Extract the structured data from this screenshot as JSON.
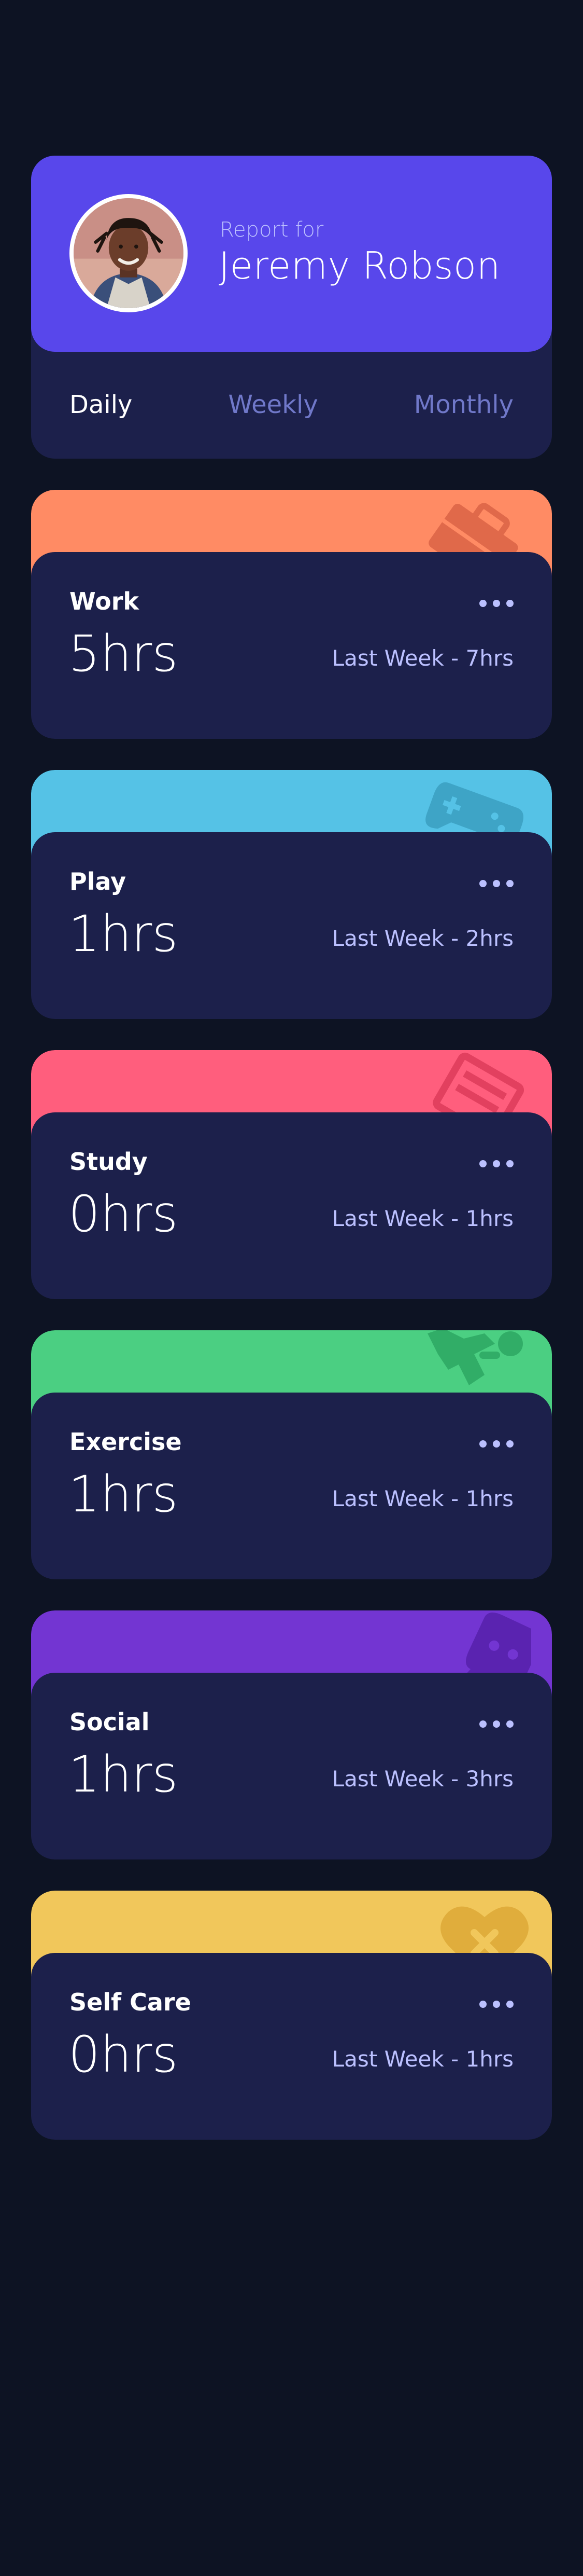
{
  "profile": {
    "report_for": "Report for",
    "name": "Jeremy Robson",
    "periods": [
      "Daily",
      "Weekly",
      "Monthly"
    ],
    "active_period": "Daily"
  },
  "activities": [
    {
      "title": "Work",
      "hours": "5hrs",
      "previous": "Last Week - 7hrs",
      "color": "#ff8b64",
      "icon": "briefcase-icon"
    },
    {
      "title": "Play",
      "hours": "1hrs",
      "previous": "Last Week - 2hrs",
      "color": "#55c2e6",
      "icon": "gamepad-icon"
    },
    {
      "title": "Study",
      "hours": "0hrs",
      "previous": "Last Week - 1hrs",
      "color": "#ff5e7d",
      "icon": "book-icon"
    },
    {
      "title": "Exercise",
      "hours": "1hrs",
      "previous": "Last Week - 1hrs",
      "color": "#4bcf82",
      "icon": "running-icon"
    },
    {
      "title": "Social",
      "hours": "1hrs",
      "previous": "Last Week - 3hrs",
      "color": "#7335d2",
      "icon": "chat-bubble-icon"
    },
    {
      "title": "Self Care",
      "hours": "0hrs",
      "previous": "Last Week - 1hrs",
      "color": "#f1c75b",
      "icon": "heart-icon"
    }
  ]
}
